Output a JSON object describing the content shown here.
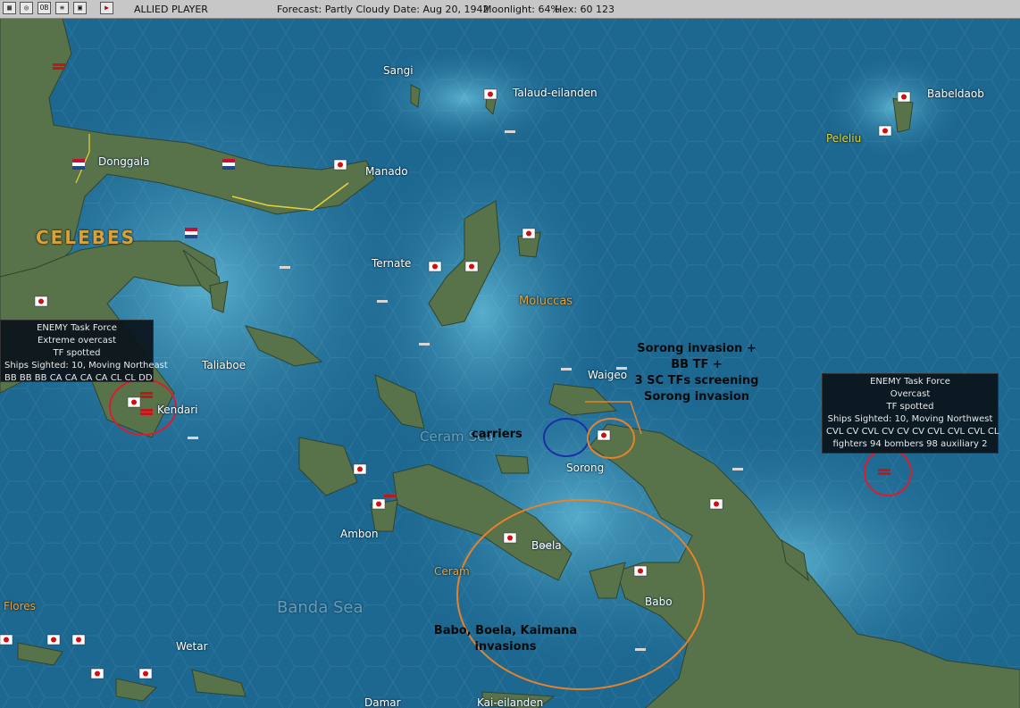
{
  "topbar": {
    "player": "ALLIED PLAYER",
    "forecast": "Forecast: Partly Cloudy",
    "date": "Date: Aug 20, 1942",
    "moonlight": "Moonlight: 64%",
    "hex": "Hex: 60 123",
    "buttons": [
      "map",
      "globe",
      "OB",
      "list",
      "sat",
      "end-turn"
    ]
  },
  "map": {
    "regions": {
      "celebes": "CELEBES",
      "moluccas": "Moluccas",
      "ceram_sea": "Ceram Sea",
      "banda_sea": "Banda Sea",
      "flores": "Flores",
      "ceram": "Ceram",
      "peleliu": "Peleliu"
    },
    "places": {
      "sangi": "Sangi",
      "talaud": "Talaud-eilanden",
      "babeldaob": "Babeldaob",
      "donggala": "Donggala",
      "manado": "Manado",
      "ternate": "Ternate",
      "taliaboe": "Taliaboe",
      "kendari": "Kendari",
      "waigeo": "Waigeo",
      "sorong": "Sorong",
      "boela": "Boela",
      "ambon": "Ambon",
      "babo": "Babo",
      "wetar": "Wetar",
      "damar": "Damar",
      "kai": "Kai-eilanden"
    },
    "annotations": {
      "sorong_l1": "Sorong invasion +",
      "sorong_l2": "BB TF +",
      "sorong_l3": "3 SC TFs screening",
      "sorong_l4": "Sorong invasion",
      "carriers": "carriers",
      "babo_l1": "Babo, Boela, Kaimana",
      "babo_l2": "invasions"
    },
    "popup_west": {
      "l1": "ENEMY Task Force",
      "l2": "Extreme overcast",
      "l3": "TF spotted",
      "l4": "Ships Sighted: 10, Moving Northeast",
      "l5": "BB BB BB CA CA CA CA CL CL DD"
    },
    "popup_east": {
      "l1": "ENEMY Task Force",
      "l2": "Overcast",
      "l3": "TF spotted",
      "l4": "Ships Sighted: 10, Moving Northwest",
      "l5": "CVL CV CVL CV CV CV CVL CVL CVL CL",
      "l6": "fighters 94  bombers 98  auxiliary 2"
    },
    "colors": {
      "sea_deep": "#1d6891",
      "sea_shallow": "#4aa3c4",
      "land": "#56704a",
      "japan_flag": "#d01010",
      "circle_red": "#d81e2e",
      "circle_orange": "#e6822a",
      "circle_blue": "#1a2fa8"
    }
  }
}
